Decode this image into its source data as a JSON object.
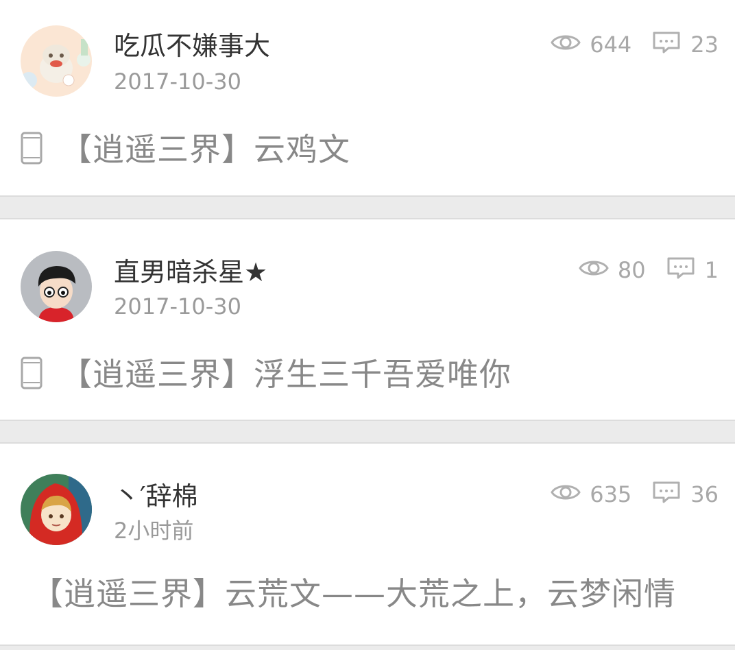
{
  "posts": [
    {
      "username": "吃瓜不嫌事大",
      "date": "2017-10-30",
      "views": "644",
      "comments": "23",
      "title": "【逍遥三界】云鸡文",
      "mobile": true
    },
    {
      "username": "直男暗杀星★",
      "date": "2017-10-30",
      "views": "80",
      "comments": "1",
      "title": "【逍遥三界】浮生三千吾爱唯你",
      "mobile": true
    },
    {
      "username": "丶′辞棉",
      "date": "2小时前",
      "views": "635",
      "comments": "36",
      "title": "【逍遥三界】云荒文——大荒之上，云梦闲情",
      "mobile": false
    }
  ],
  "colors": {
    "background": "#ebebeb",
    "card": "#ffffff",
    "username": "#333333",
    "meta": "#9a9a9a",
    "title": "#888888",
    "icon": "#a8a8a8"
  }
}
